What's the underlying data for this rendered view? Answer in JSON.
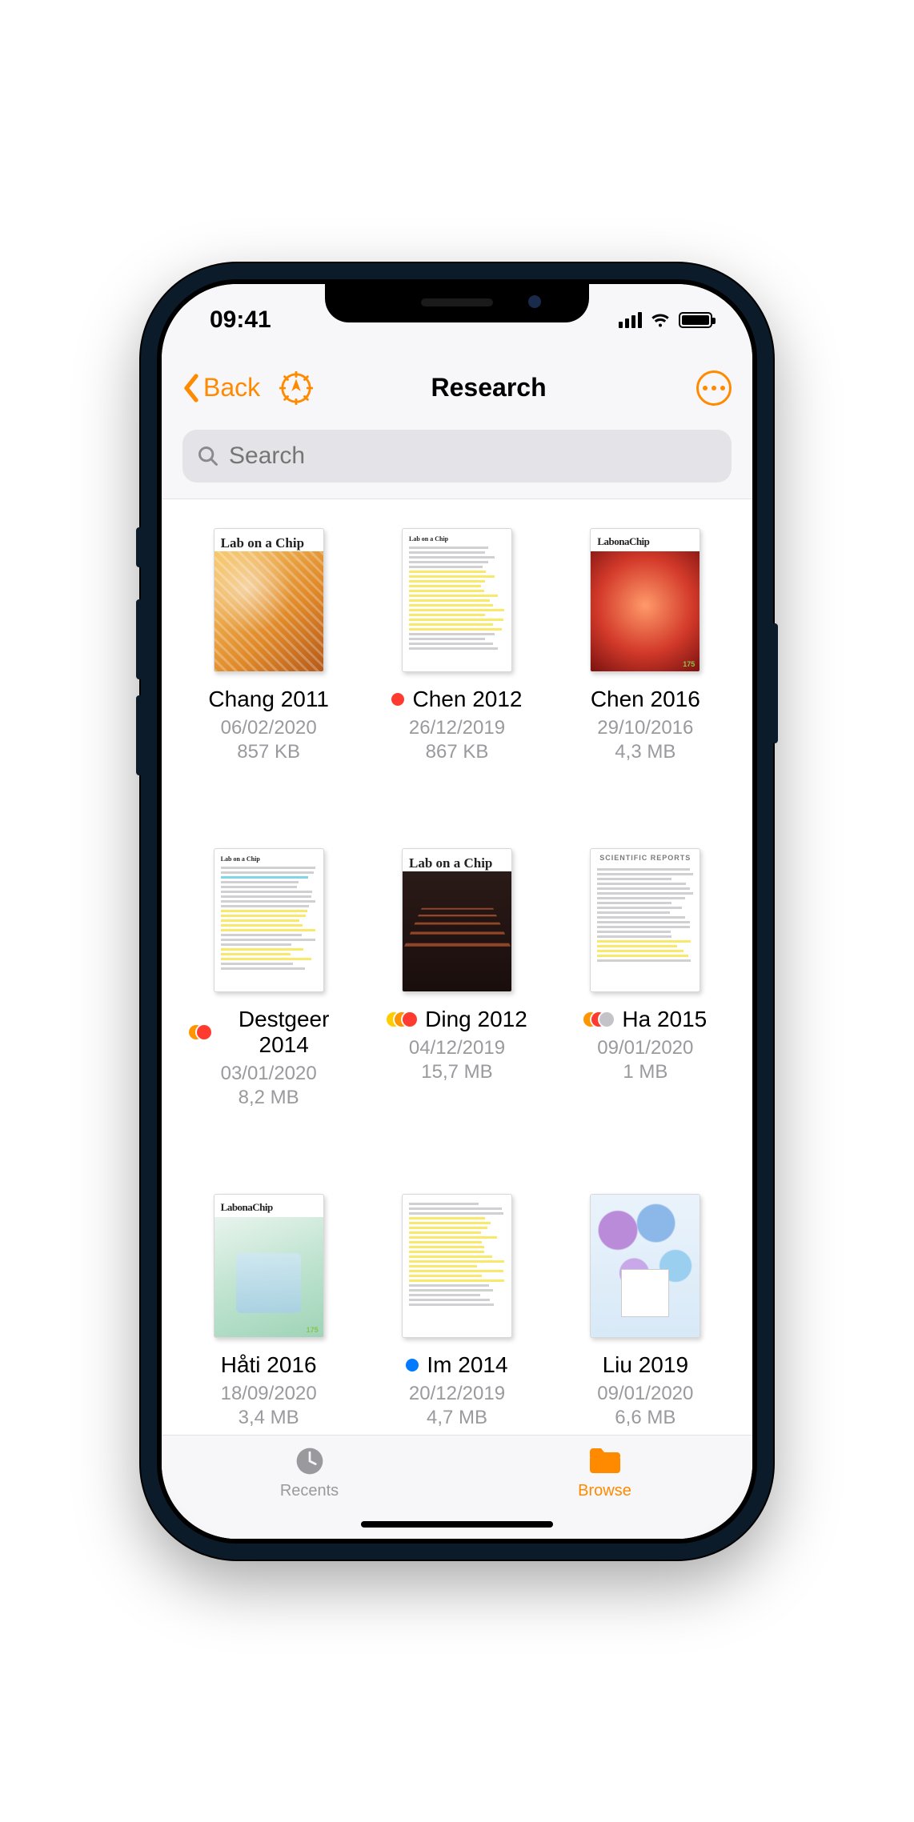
{
  "status": {
    "time": "09:41"
  },
  "nav": {
    "back_label": "Back",
    "title": "Research"
  },
  "search": {
    "placeholder": "Search"
  },
  "tag_colors": {
    "red": "#ff3b30",
    "orange": "#ff9500",
    "yellow": "#ffcc00",
    "grey": "#c4c4c8",
    "blue": "#007aff"
  },
  "files": [
    {
      "name": "Chang 2011",
      "date": "06/02/2020",
      "size": "857 KB",
      "tags": [],
      "thumb_kind": "loc-cover-orange"
    },
    {
      "name": "Chen 2012",
      "date": "26/12/2019",
      "size": "867 KB",
      "tags": [
        "red"
      ],
      "thumb_kind": "paper-yellow"
    },
    {
      "name": "Chen 2016",
      "date": "29/10/2016",
      "size": "4,3 MB",
      "tags": [],
      "thumb_kind": "loc-cover-red"
    },
    {
      "name": "Destgeer 2014",
      "date": "03/01/2020",
      "size": "8,2 MB",
      "tags": [
        "orange",
        "red"
      ],
      "thumb_kind": "paper-cyan"
    },
    {
      "name": "Ding 2012",
      "date": "04/12/2019",
      "size": "15,7 MB",
      "tags": [
        "yellow",
        "orange",
        "red"
      ],
      "thumb_kind": "loc-cover-dark"
    },
    {
      "name": "Ha 2015",
      "date": "09/01/2020",
      "size": "1 MB",
      "tags": [
        "orange",
        "red",
        "grey"
      ],
      "thumb_kind": "sci-reports"
    },
    {
      "name": "Håti 2016",
      "date": "18/09/2020",
      "size": "3,4 MB",
      "tags": [],
      "thumb_kind": "loc-cover-green"
    },
    {
      "name": "Im 2014",
      "date": "20/12/2019",
      "size": "4,7 MB",
      "tags": [
        "blue"
      ],
      "thumb_kind": "paper-yellow2"
    },
    {
      "name": "Liu 2019",
      "date": "09/01/2020",
      "size": "6,6 MB",
      "tags": [],
      "thumb_kind": "cover-cells"
    }
  ],
  "tabs": {
    "recents": "Recents",
    "browse": "Browse"
  },
  "thumb_titles": {
    "lab_on_chip": "Lab on a Chip",
    "lab_on_chip_condensed": "LabonaChip",
    "scientific_reports": "SCIENTIFIC REPORTS",
    "issue_badge": "175"
  }
}
